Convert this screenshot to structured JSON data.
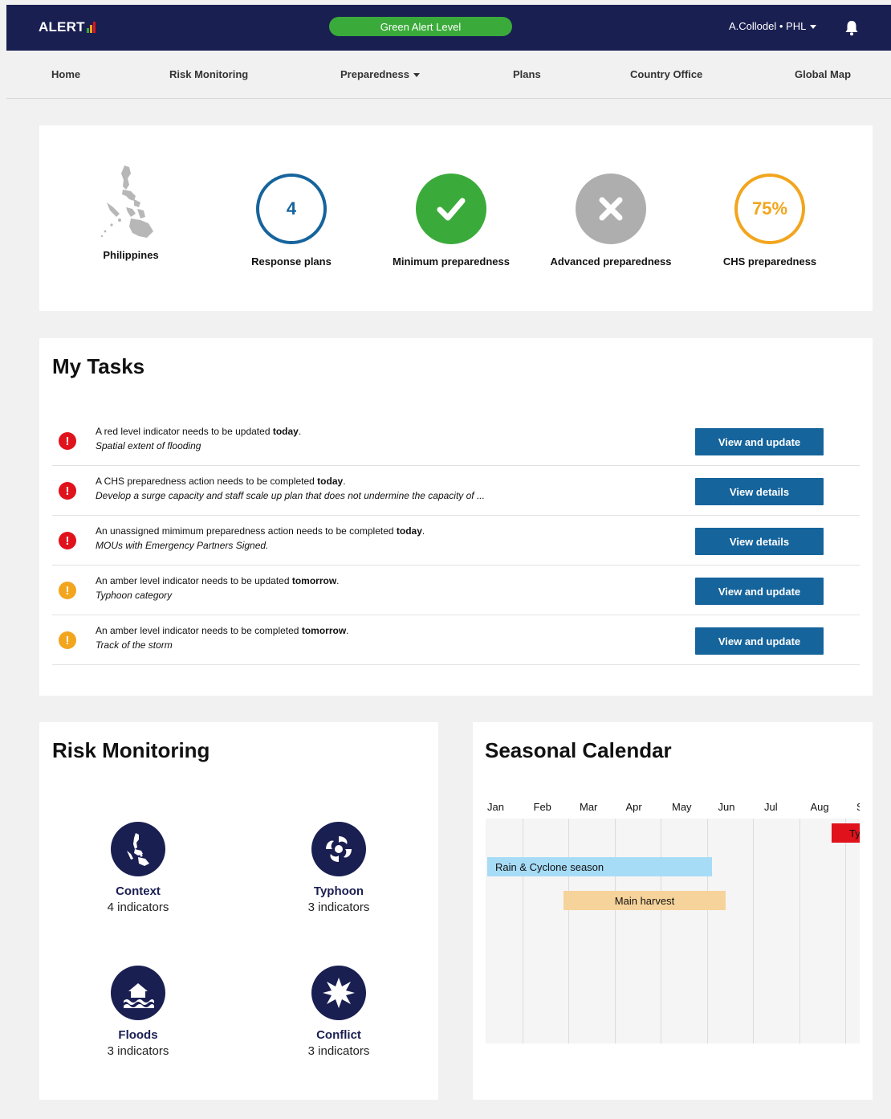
{
  "header": {
    "logo_text": "ALERT",
    "alert_level": "Green Alert Level",
    "user": "A.Collodel • PHL",
    "colors": {
      "bar": "#1a1f52",
      "alert_green": "#3aab3a"
    }
  },
  "nav": {
    "home": "Home",
    "risk_monitoring": "Risk Monitoring",
    "preparedness": "Preparedness",
    "plans": "Plans",
    "country_office": "Country Office",
    "global_map": "Global Map"
  },
  "overview": {
    "country": "Philippines",
    "response_plans_count": "4",
    "response_plans_label": "Response plans",
    "minimum_label": "Minimum preparedness",
    "advanced_label": "Advanced preparedness",
    "chs_value": "75%",
    "chs_label": "CHS preparedness"
  },
  "tasks": {
    "title": "My Tasks",
    "items": [
      {
        "pre": "A red level indicator needs to be updated ",
        "bold": "today",
        "post": ".",
        "detail": "Spatial extent of flooding",
        "action": "View and update",
        "level": "red"
      },
      {
        "pre": "A CHS preparedness action needs to be completed ",
        "bold": "today",
        "post": ".",
        "detail": "Develop a surge capacity and staff scale up plan that does not undermine the capacity of ...",
        "action": "View details",
        "level": "red"
      },
      {
        "pre": "An unassigned mimimum preparedness action needs to be completed ",
        "bold": "today",
        "post": ".",
        "detail": "MOUs with Emergency Partners Signed.",
        "action": "View details",
        "level": "red"
      },
      {
        "pre": "An amber level indicator needs to be updated ",
        "bold": "tomorrow",
        "post": ".",
        "detail": "Typhoon category",
        "action": "View and update",
        "level": "amber"
      },
      {
        "pre": "An amber level indicator needs to be completed ",
        "bold": "tomorrow",
        "post": ".",
        "detail": "Track of the storm",
        "action": "View and update",
        "level": "amber"
      }
    ]
  },
  "risk": {
    "title": "Risk Monitoring",
    "items": [
      {
        "name": "Context",
        "count": "4 indicators"
      },
      {
        "name": "Typhoon",
        "count": "3 indicators"
      },
      {
        "name": "Floods",
        "count": "3 indicators"
      },
      {
        "name": "Conflict",
        "count": "3 indicators"
      }
    ]
  },
  "calendar": {
    "title": "Seasonal Calendar",
    "months": [
      "Jan",
      "Feb",
      "Mar",
      "Apr",
      "May",
      "Jun",
      "Jul",
      "Aug",
      "S"
    ],
    "events": [
      {
        "label": "Ty",
        "color": "#e0121b"
      },
      {
        "label": "Rain & Cyclone season",
        "color": "#a7dcf7"
      },
      {
        "label": "Main harvest",
        "color": "#f6d39a"
      }
    ]
  }
}
